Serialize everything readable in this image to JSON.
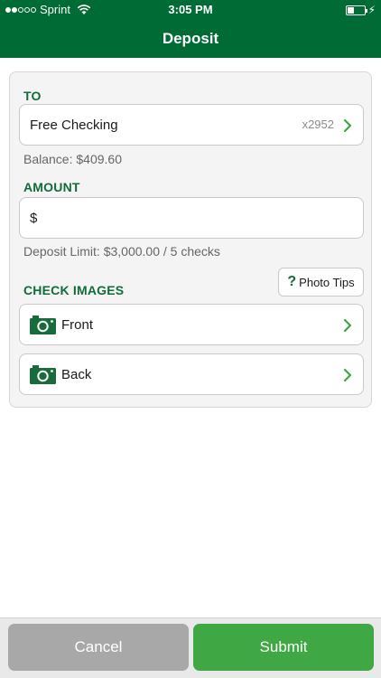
{
  "status_bar": {
    "carrier": "Sprint",
    "time": "3:05 PM"
  },
  "header": {
    "title": "Deposit"
  },
  "to_section": {
    "label": "TO",
    "account_name": "Free Checking",
    "account_number": "x2952",
    "balance_text": "Balance: $409.60"
  },
  "amount_section": {
    "label": "AMOUNT",
    "currency_symbol": "$",
    "limit_text": "Deposit Limit: $3,000.00 / 5 checks"
  },
  "check_images": {
    "label": "CHECK IMAGES",
    "photo_tips_label": "Photo Tips",
    "front_label": "Front",
    "back_label": "Back"
  },
  "footer": {
    "cancel_label": "Cancel",
    "submit_label": "Submit"
  },
  "colors": {
    "brand_green": "#006b35",
    "accent_green": "#3fa744",
    "cancel_gray": "#a8a8a8"
  }
}
